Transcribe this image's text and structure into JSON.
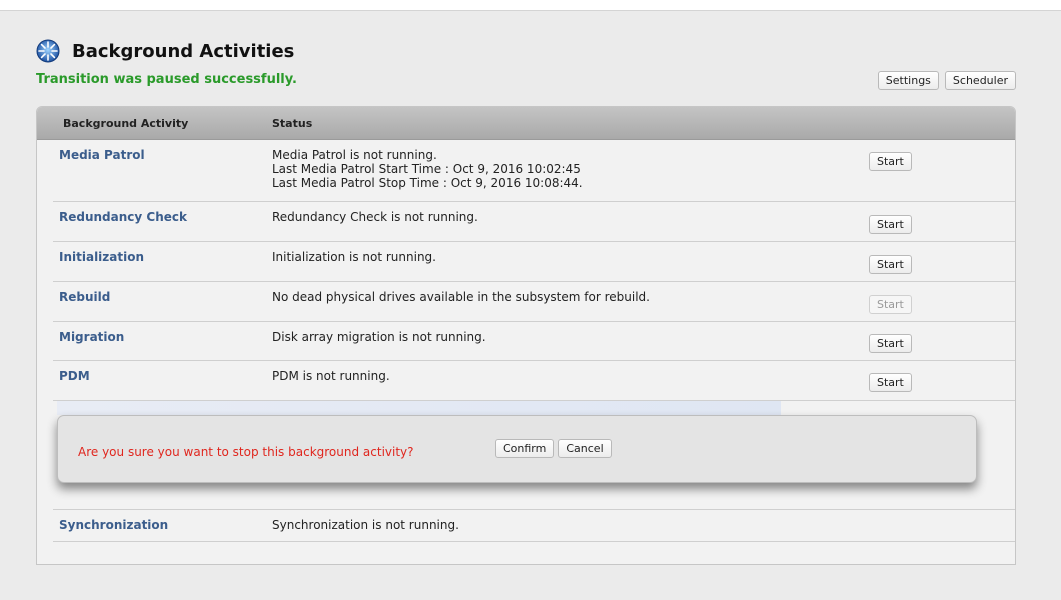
{
  "header": {
    "title": "Background Activities",
    "icon": "globe-icon",
    "status_message": "Transition was paused successfully.",
    "settings_label": "Settings",
    "scheduler_label": "Scheduler"
  },
  "table": {
    "columns": [
      "Background Activity",
      "Status"
    ],
    "rows": [
      {
        "name": "Media Patrol",
        "status_lines": [
          "Media Patrol is not running.",
          "Last Media Patrol Start Time : Oct 9, 2016 10:02:45",
          "Last Media Patrol Stop Time : Oct 9, 2016 10:08:44."
        ],
        "button": "Start",
        "button_enabled": true
      },
      {
        "name": "Redundancy Check",
        "status_lines": [
          "Redundancy Check is not running."
        ],
        "button": "Start",
        "button_enabled": true
      },
      {
        "name": "Initialization",
        "status_lines": [
          "Initialization is not running."
        ],
        "button": "Start",
        "button_enabled": true
      },
      {
        "name": "Rebuild",
        "status_lines": [
          "No dead physical drives available in the subsystem for rebuild."
        ],
        "button": "Start",
        "button_enabled": false
      },
      {
        "name": "Migration",
        "status_lines": [
          "Disk array migration is not running."
        ],
        "button": "Start",
        "button_enabled": true
      },
      {
        "name": "PDM",
        "status_lines": [
          "PDM is not running."
        ],
        "button": "Start",
        "button_enabled": true
      },
      {
        "name": "Synchronization",
        "status_lines": [
          "Synchronization is not running."
        ]
      }
    ]
  },
  "dialog": {
    "question": "Are you sure you want to stop this background activity?",
    "confirm_label": "Confirm",
    "cancel_label": "Cancel"
  },
  "colors": {
    "success_text": "#2a9a2a",
    "link_text": "#3b5d8c",
    "warning_text": "#e0261e"
  }
}
